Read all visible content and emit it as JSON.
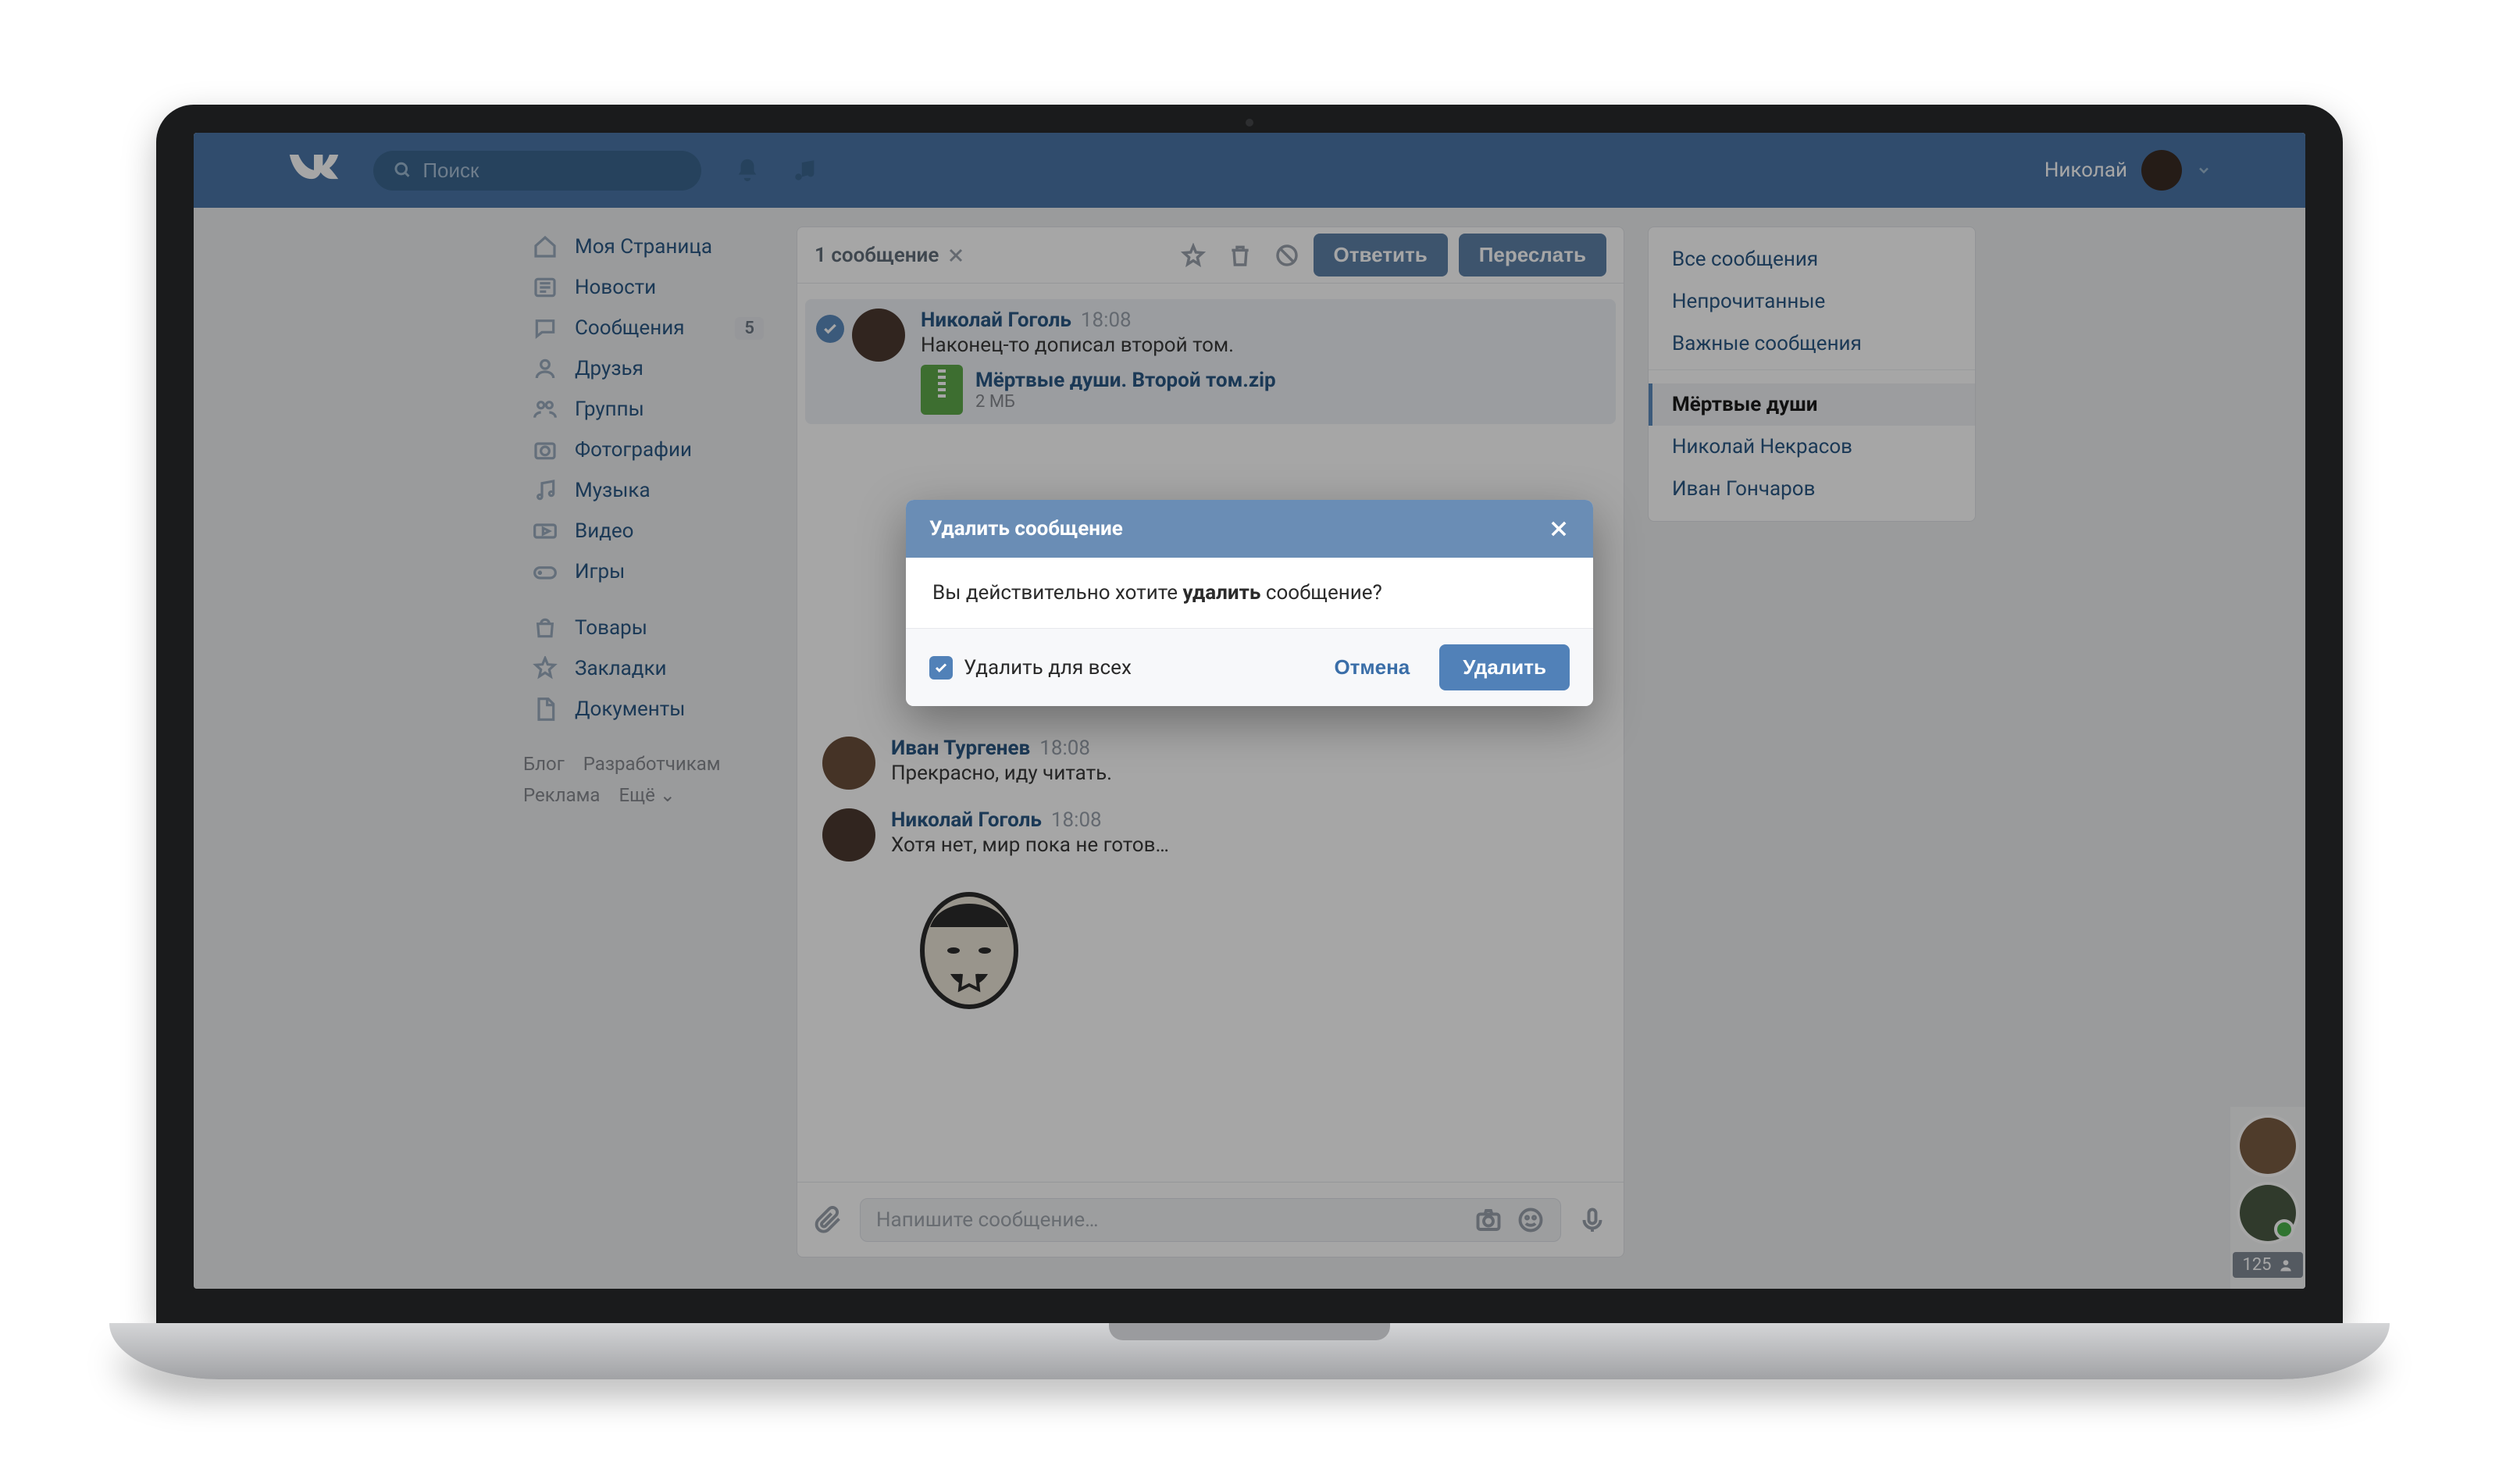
{
  "header": {
    "search_placeholder": "Поиск",
    "user_name": "Николай"
  },
  "sidebar": {
    "items": [
      {
        "label": "Моя Страница"
      },
      {
        "label": "Новости"
      },
      {
        "label": "Сообщения",
        "badge": "5"
      },
      {
        "label": "Друзья"
      },
      {
        "label": "Группы"
      },
      {
        "label": "Фотографии"
      },
      {
        "label": "Музыка"
      },
      {
        "label": "Видео"
      },
      {
        "label": "Игры"
      }
    ],
    "items2": [
      {
        "label": "Товары"
      },
      {
        "label": "Закладки"
      },
      {
        "label": "Документы"
      }
    ],
    "footer": [
      "Блог",
      "Разработчикам",
      "Реклама",
      "Ещё ⌄"
    ]
  },
  "thread": {
    "selection_label": "1 сообщение",
    "reply_btn": "Ответить",
    "forward_btn": "Переслать",
    "messages": [
      {
        "name": "Николай Гоголь",
        "time": "18:08",
        "text": "Наконец-то дописал второй том.",
        "file_name": "Мёртвые души. Второй том.zip",
        "file_size": "2 МБ",
        "selected": true
      },
      {
        "name": "Иван Тургенев",
        "time": "18:08",
        "text": "Прекрасно, иду читать."
      },
      {
        "name": "Николай Гоголь",
        "time": "18:08",
        "text": "Хотя нет, мир пока не готов…",
        "sticker": true
      }
    ],
    "compose_placeholder": "Напишите сообщение…"
  },
  "filters": [
    "Все сообщения",
    "Непрочитанные",
    "Важные сообщения",
    "Мёртвые души",
    "Николай Некрасов",
    "Иван Гончаров"
  ],
  "filters_active": "Мёртвые души",
  "floaters": {
    "count": "125"
  },
  "modal": {
    "title": "Удалить сообщение",
    "body_pre": "Вы действительно хотите ",
    "body_bold": "удалить",
    "body_post": " сообщение?",
    "checkbox_label": "Удалить для всех",
    "cancel": "Отмена",
    "confirm": "Удалить"
  }
}
